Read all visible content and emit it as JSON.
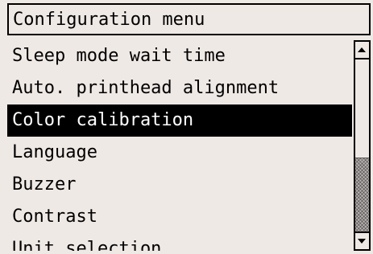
{
  "menu": {
    "title": "Configuration menu",
    "items": [
      {
        "label": "Sleep mode wait time",
        "selected": false
      },
      {
        "label": "Auto. printhead alignment",
        "selected": false
      },
      {
        "label": "Color calibration",
        "selected": true
      },
      {
        "label": "Language",
        "selected": false
      },
      {
        "label": "Buzzer",
        "selected": false
      },
      {
        "label": "Contrast",
        "selected": false
      },
      {
        "label": "Unit selection",
        "selected": false
      }
    ]
  },
  "scrollbar": {
    "up_icon": "arrow-up-icon",
    "down_icon": "arrow-down-icon",
    "thumb_start_fraction": 0.57,
    "thumb_end_fraction": 1.0
  },
  "colors": {
    "background": "#efe9e6",
    "selected_background": "#000000",
    "selected_text": "#ffffff"
  }
}
